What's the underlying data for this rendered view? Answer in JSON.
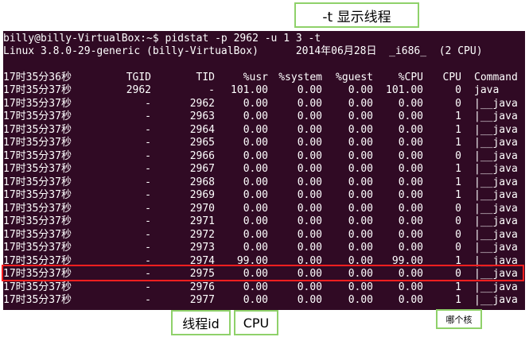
{
  "callouts": {
    "top": "-t 显示线程",
    "tid": "线程id",
    "cpu": "CPU",
    "core": "哪个核"
  },
  "terminal": {
    "prompt_line": "billy@billy-VirtualBox:~$ pidstat -p 2962 -u 1 3 -t",
    "info_line": "Linux 3.8.0-29-generic (billy-VirtualBox)      2014年06月28日  _i686_  (2 CPU)",
    "headers": [
      "17时35分36秒",
      "TGID",
      "TID",
      "%usr",
      "%system",
      "%guest",
      "%CPU",
      "CPU",
      "Command"
    ],
    "rows": [
      [
        "17时35分37秒",
        "2962",
        "-",
        "101.00",
        "0.00",
        "0.00",
        "101.00",
        "0",
        "java"
      ],
      [
        "17时35分37秒",
        "-",
        "2962",
        "0.00",
        "0.00",
        "0.00",
        "0.00",
        "0",
        "|__java"
      ],
      [
        "17时35分37秒",
        "-",
        "2963",
        "0.00",
        "0.00",
        "0.00",
        "0.00",
        "1",
        "|__java"
      ],
      [
        "17时35分37秒",
        "-",
        "2964",
        "0.00",
        "0.00",
        "0.00",
        "0.00",
        "1",
        "|__java"
      ],
      [
        "17时35分37秒",
        "-",
        "2965",
        "0.00",
        "0.00",
        "0.00",
        "0.00",
        "1",
        "|__java"
      ],
      [
        "17时35分37秒",
        "-",
        "2966",
        "0.00",
        "0.00",
        "0.00",
        "0.00",
        "0",
        "|__java"
      ],
      [
        "17时35分37秒",
        "-",
        "2967",
        "0.00",
        "0.00",
        "0.00",
        "0.00",
        "1",
        "|__java"
      ],
      [
        "17时35分37秒",
        "-",
        "2968",
        "0.00",
        "0.00",
        "0.00",
        "0.00",
        "1",
        "|__java"
      ],
      [
        "17时35分37秒",
        "-",
        "2969",
        "0.00",
        "0.00",
        "0.00",
        "0.00",
        "1",
        "|__java"
      ],
      [
        "17时35分37秒",
        "-",
        "2970",
        "0.00",
        "0.00",
        "0.00",
        "0.00",
        "0",
        "|__java"
      ],
      [
        "17时35分37秒",
        "-",
        "2971",
        "0.00",
        "0.00",
        "0.00",
        "0.00",
        "0",
        "|__java"
      ],
      [
        "17时35分37秒",
        "-",
        "2972",
        "0.00",
        "0.00",
        "0.00",
        "0.00",
        "0",
        "|__java"
      ],
      [
        "17时35分37秒",
        "-",
        "2973",
        "0.00",
        "0.00",
        "0.00",
        "0.00",
        "0",
        "|__java"
      ],
      [
        "17时35分37秒",
        "-",
        "2974",
        "99.00",
        "0.00",
        "0.00",
        "99.00",
        "1",
        "|__java"
      ],
      [
        "17时35分37秒",
        "-",
        "2975",
        "0.00",
        "0.00",
        "0.00",
        "0.00",
        "0",
        "|__java"
      ],
      [
        "17时35分37秒",
        "-",
        "2976",
        "0.00",
        "0.00",
        "0.00",
        "0.00",
        "1",
        "|__java"
      ],
      [
        "17时35分37秒",
        "-",
        "2977",
        "0.00",
        "0.00",
        "0.00",
        "0.00",
        "1",
        "|__java"
      ]
    ]
  },
  "colors": {
    "terminal_bg": "#300a24",
    "terminal_text": "#ffffff",
    "callout_border": "#8fd16a",
    "highlight_border": "#ff1f1f"
  }
}
